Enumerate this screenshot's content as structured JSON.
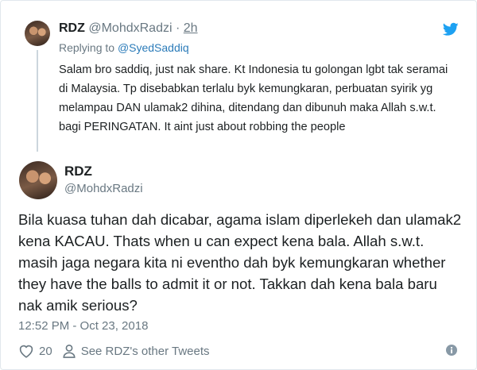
{
  "parent_tweet": {
    "display_name": "RDZ",
    "handle": "@MohdxRadzi",
    "separator": "·",
    "time": "2h",
    "replying_prefix": "Replying to",
    "replying_mention": "@SyedSaddiq",
    "text": "Salam bro saddiq, just nak share. Kt Indonesia tu golongan lgbt tak seramai di Malaysia. Tp disebabkan terlalu byk kemungkaran, perbuatan syirik yg melampau DAN ulamak2 dihina, ditendang dan dibunuh maka Allah s.w.t. bagi PERINGATAN. It aint just about robbing the people"
  },
  "main_tweet": {
    "display_name": "RDZ",
    "handle": "@MohdxRadzi",
    "text": "Bila kuasa tuhan dah dicabar, agama islam diperlekeh dan ulamak2 kena KACAU. Thats when u can expect kena bala. Allah s.w.t. masih jaga negara kita ni eventho dah byk kemungkaran whether they have the balls to admit it or not. Takkan dah kena bala baru nak amik serious?",
    "timestamp": "12:52 PM - Oct 23, 2018",
    "like_count": "20",
    "other_tweets_label": "See RDZ's other Tweets"
  },
  "icons": {
    "brand": "twitter-bird-icon",
    "like": "heart-icon",
    "profile": "person-icon",
    "info": "info-icon"
  },
  "colors": {
    "brand_blue": "#1da1f2",
    "link_blue": "#2b7bb9",
    "muted_gray": "#697882",
    "text": "#1c2022"
  }
}
